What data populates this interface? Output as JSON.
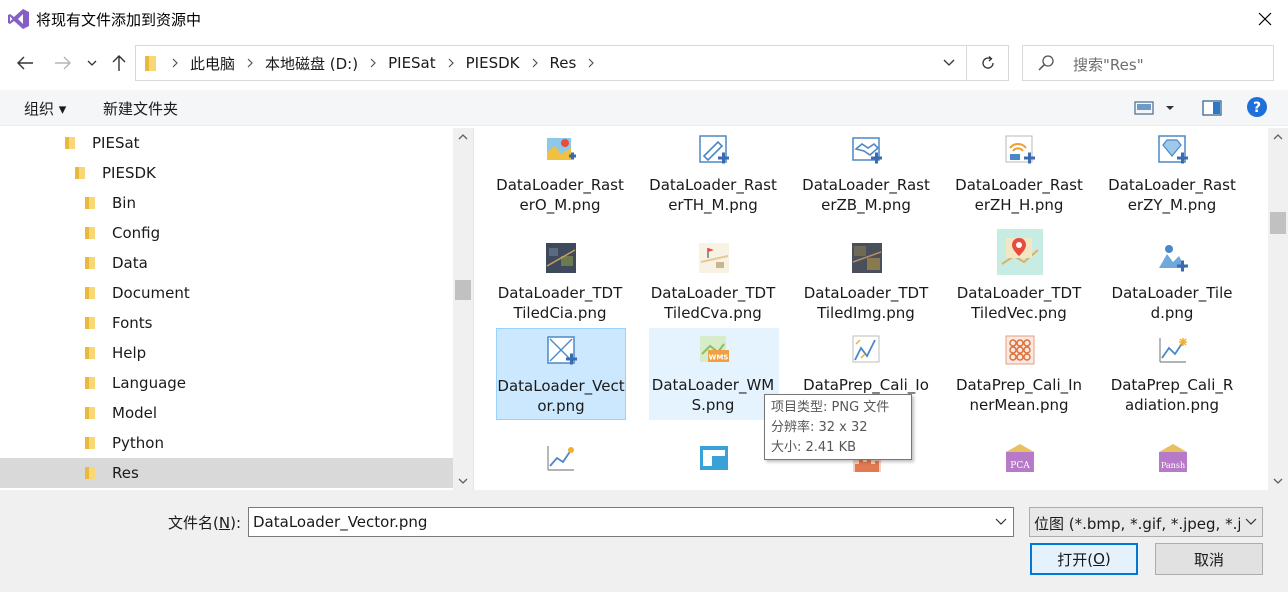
{
  "window": {
    "title": "将现有文件添加到资源中"
  },
  "address": {
    "crumbs": [
      "此电脑",
      "本地磁盘 (D:)",
      "PIESat",
      "PIESDK",
      "Res"
    ],
    "search_placeholder": "搜索\"Res\""
  },
  "toolbar": {
    "organize_label": "组织 ▾",
    "new_folder_label": "新建文件夹"
  },
  "tree": {
    "items": [
      {
        "label": "PIESat"
      },
      {
        "label": "PIESDK"
      },
      {
        "label": "Bin"
      },
      {
        "label": "Config"
      },
      {
        "label": "Data"
      },
      {
        "label": "Document"
      },
      {
        "label": "Fonts"
      },
      {
        "label": "Help"
      },
      {
        "label": "Language"
      },
      {
        "label": "Model"
      },
      {
        "label": "Python"
      },
      {
        "label": "Res"
      }
    ]
  },
  "files": {
    "items": [
      {
        "name": "DataLoader_RasterO_M.png",
        "icon": "raster-map-icon"
      },
      {
        "name": "DataLoader_RasterTH_M.png",
        "icon": "raster-edit-icon"
      },
      {
        "name": "DataLoader_RasterZB_M.png",
        "icon": "raster-handshake-icon"
      },
      {
        "name": "DataLoader_RasterZH_H.png",
        "icon": "raster-signal-icon"
      },
      {
        "name": "DataLoader_RasterZY_M.png",
        "icon": "raster-diamond-icon"
      },
      {
        "name": "DataLoader_TDTTiledCia.png",
        "icon": "satellite-photo-icon"
      },
      {
        "name": "DataLoader_TDTTiledCva.png",
        "icon": "map-flag-icon"
      },
      {
        "name": "DataLoader_TDTTiledImg.png",
        "icon": "satellite-image-icon"
      },
      {
        "name": "DataLoader_TDTTiledVec.png",
        "icon": "vector-map-icon"
      },
      {
        "name": "DataLoader_Tiled.png",
        "icon": "tiled-map-icon"
      },
      {
        "name": "DataLoader_Vector.png",
        "icon": "vector-add-icon"
      },
      {
        "name": "DataLoader_WMS.png",
        "icon": "wms-map-icon"
      },
      {
        "name": "DataPrep_Cali_Ion",
        "icon": "calibration-chart-icon"
      },
      {
        "name": "DataPrep_Cali_InnerMean.png",
        "icon": "grid-dots-icon"
      },
      {
        "name": "DataPrep_Cali_Radiation.png",
        "icon": "radiation-chart-icon"
      },
      {
        "name": "",
        "icon": "line-chart-icon"
      },
      {
        "name": "",
        "icon": "window-icon"
      },
      {
        "name": "",
        "icon": "histogram-icon"
      },
      {
        "name": "",
        "icon": "pca-icon"
      },
      {
        "name": "",
        "icon": "pansh-icon"
      }
    ],
    "pca_label": "PCA",
    "pansh_label": "Pansh",
    "wms_label": "WMS"
  },
  "tooltip": {
    "line1": "项目类型: PNG 文件",
    "line2": "分辨率: 32 x 32",
    "line3": "大小: 2.41 KB"
  },
  "bottom": {
    "filename_label_pre": "文件名(",
    "filename_label_key": "N",
    "filename_label_post": "):",
    "filename_value": "DataLoader_Vector.png",
    "filetype_value": "位图 (*.bmp, *.gif, *.jpeg, *.jp",
    "open_pre": "打开(",
    "open_key": "O",
    "open_post": ")",
    "cancel_label": "取消"
  },
  "colors": {
    "selection": "#cce8ff",
    "hover": "#e5f3ff",
    "folder": "#f8d775",
    "accent": "#0078d7"
  }
}
